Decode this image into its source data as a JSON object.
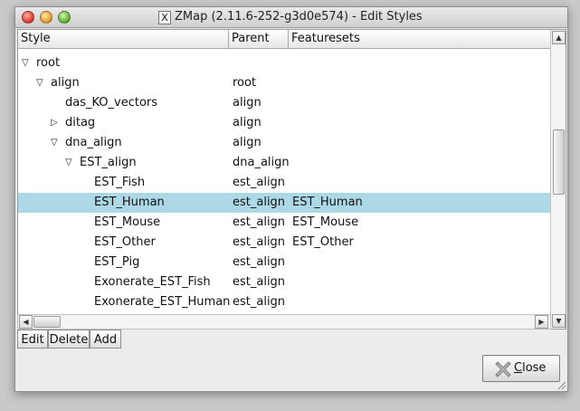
{
  "window": {
    "title": "ZMap (2.11.6-252-g3d0e574) - Edit Styles",
    "app_icon_glyph": "X"
  },
  "columns": [
    "Style",
    "Parent",
    "Featuresets"
  ],
  "rows": [
    {
      "style": "root",
      "parent": "",
      "featuresets": "",
      "indent": 0,
      "expander": "expanded"
    },
    {
      "style": "align",
      "parent": "root",
      "featuresets": "",
      "indent": 1,
      "expander": "expanded"
    },
    {
      "style": "das_KO_vectors",
      "parent": "align",
      "featuresets": "",
      "indent": 2,
      "expander": "none"
    },
    {
      "style": "ditag",
      "parent": "align",
      "featuresets": "",
      "indent": 2,
      "expander": "collapsed"
    },
    {
      "style": "dna_align",
      "parent": "align",
      "featuresets": "",
      "indent": 2,
      "expander": "expanded"
    },
    {
      "style": "EST_align",
      "parent": "dna_align",
      "featuresets": "",
      "indent": 3,
      "expander": "expanded"
    },
    {
      "style": "EST_Fish",
      "parent": "est_align",
      "featuresets": "",
      "indent": 4,
      "expander": "none"
    },
    {
      "style": "EST_Human",
      "parent": "est_align",
      "featuresets": "EST_Human",
      "indent": 4,
      "expander": "none",
      "selected": true
    },
    {
      "style": "EST_Mouse",
      "parent": "est_align",
      "featuresets": "EST_Mouse",
      "indent": 4,
      "expander": "none"
    },
    {
      "style": "EST_Other",
      "parent": "est_align",
      "featuresets": "EST_Other",
      "indent": 4,
      "expander": "none"
    },
    {
      "style": "EST_Pig",
      "parent": "est_align",
      "featuresets": "",
      "indent": 4,
      "expander": "none"
    },
    {
      "style": "Exonerate_EST_Fish",
      "parent": "est_align",
      "featuresets": "",
      "indent": 4,
      "expander": "none"
    },
    {
      "style": "Exonerate_EST_Human",
      "parent": "est_align",
      "featuresets": "",
      "indent": 4,
      "expander": "none"
    }
  ],
  "buttons": {
    "edit": "Edit",
    "delete": "Delete",
    "add": "Add",
    "close_prefix": "",
    "close_mnemonic": "C",
    "close_rest": "lose"
  },
  "colors": {
    "selection": "#add8e6",
    "close_icon": "#8a8a8a"
  },
  "icons": {
    "close": "x-close-icon",
    "expanded": "triangle-down-icon",
    "collapsed": "triangle-right-icon"
  }
}
